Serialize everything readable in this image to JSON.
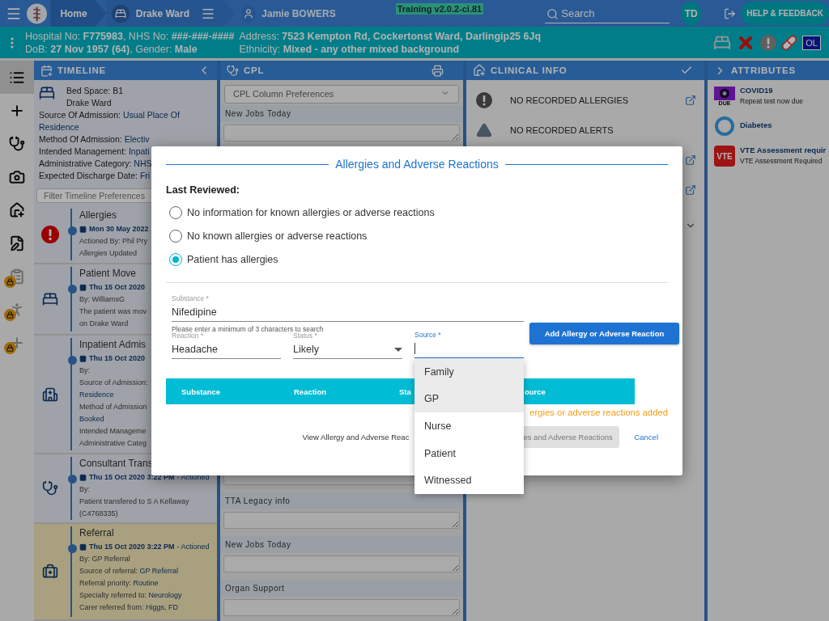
{
  "topbar": {
    "home": "Home",
    "ward": "Drake Ward",
    "patient": "Jamie BOWERS",
    "version": "Training v2.0.2-ci.81",
    "search": {
      "placeholder": "Search"
    },
    "avatar": "TD",
    "help": "HELP & FEEDBACK"
  },
  "patient_bar": {
    "left": [
      "Hospital No: **F775983**, NHS No: **###-###-####**",
      "DoB: **27 Nov 1957 (64)**, Gender: **Male**"
    ],
    "right": [
      "Address: **7523 Kempton Rd, Cockertonst Ward, Darlingip25 6Jq**",
      "Ethnicity: **Mixed - any other mixed background**"
    ],
    "badge": "OL"
  },
  "rail": [
    {
      "kind": "list",
      "selected": true,
      "locked": false
    },
    {
      "kind": "plus",
      "selected": false,
      "locked": false
    },
    {
      "kind": "stethoscope",
      "selected": false,
      "locked": false
    },
    {
      "kind": "camera",
      "selected": false,
      "locked": false
    },
    {
      "kind": "home",
      "selected": false,
      "locked": false
    },
    {
      "kind": "document",
      "selected": false,
      "locked": false
    },
    {
      "kind": "clipboard",
      "selected": false,
      "locked": true
    },
    {
      "kind": "walker",
      "selected": false,
      "locked": true
    },
    {
      "kind": "plus",
      "selected": false,
      "locked": true
    }
  ],
  "timeline": {
    "title": "TIMELINE",
    "bed": "Bed Space: B1",
    "ward": "Drake Ward",
    "summary": [
      "Source Of Admission: **Usual Place Of Residence**",
      "Method Of Admission: **Electiv**",
      "Intended Management: **Inpati**",
      "Administrative Category: **NHS**",
      "Expected Discharge Date: **Fri**"
    ],
    "filter": {
      "placeholder": "Filter Timeline Preferences"
    },
    "events": [
      {
        "kind": "alert",
        "title": "Allergies",
        "date": "Mon 30 May 2022",
        "lines": [
          "Actioned By: Phil Pry",
          "Allergies Updated"
        ],
        "highlighted": false
      },
      {
        "kind": "bed",
        "title": "Patient Move",
        "date": "Thu 15 Oct 2020",
        "lines": [
          "By: WilliamsG",
          "The patient was mov",
          "on Drake Ward"
        ],
        "highlighted": false
      },
      {
        "kind": "hospital",
        "title": "Inpatient Admis",
        "date": "Thu 15 Oct 2020",
        "lines": [
          "By:",
          "Source of Admission:",
          "**Residence**",
          "Method of Admission",
          "**Booked**",
          "Intended Manageme",
          "Administrative Categ"
        ],
        "highlighted": false
      },
      {
        "kind": "stethoscope",
        "title": "Consultant Trans",
        "date": "Thu 15 Oct 2020 3:22 PM",
        "status": "- Actioned",
        "lines": [
          "By:",
          "Patient transfered to S A Kellaway (C4768335)"
        ],
        "highlighted": false
      },
      {
        "kind": "medkit",
        "title": "Referral",
        "date": "Thu 15 Oct 2020 3:22 PM",
        "status": "- Actioned",
        "lines": [
          "By: GP Referral",
          "Source of referral: **GP Referral**",
          "Referral priority: **Routine**",
          "Specialty referred to: **Neurology**",
          "Carer referred from: **Higgs, FD**"
        ],
        "highlighted": true
      }
    ]
  },
  "cpl": {
    "title": "CPL",
    "select": "CPL Column Preferences",
    "sections": [
      {
        "label": "New Jobs Today"
      },
      {
        "label": "TTA Legacy info"
      },
      {
        "label": "New Jobs Today"
      },
      {
        "label": "Organ Support"
      }
    ]
  },
  "clinical_info": {
    "title": "CLINICAL INFO",
    "items": [
      {
        "kind": "allergy",
        "label": "NO RECORDED ALLERGIES"
      },
      {
        "kind": "alert",
        "label": "NO RECORDED ALERTS"
      }
    ]
  },
  "attributes": {
    "title": "ATTRIBUTES",
    "items": [
      {
        "kind": "covid",
        "badge": "DUE",
        "name": "COVID19",
        "detail": "Repeat test now due"
      },
      {
        "kind": "diabetes",
        "name": "Diabetes"
      },
      {
        "kind": "vte",
        "badge": "VTE",
        "name": "VTE Assessment requir",
        "detail": "VTE Assessment Required"
      }
    ]
  },
  "dialog": {
    "title": "Allergies and Adverse Reactions",
    "reviewed_label": "Last Reviewed:",
    "options": [
      {
        "label": "No information for known allergies or adverse reactions",
        "selected": false
      },
      {
        "label": "No known allergies or adverse reactions",
        "selected": false
      },
      {
        "label": "Patient has allergies",
        "selected": true
      }
    ],
    "substance": {
      "label": "Substance *",
      "value": "Nifedipine",
      "hint": "Please enter a minimum of 3 characters to search"
    },
    "reaction": {
      "label": "Reaction *",
      "value": "Headache"
    },
    "status": {
      "label": "Status *",
      "value": "Likely"
    },
    "source": {
      "label": "Source *",
      "focused": true
    },
    "add_button": "Add Allergy or Adverse Reaction",
    "table_columns": [
      "Substance",
      "Reaction",
      "Sta",
      "ource"
    ],
    "message": "ergies or adverse reactions added",
    "view_link": "View Allergy and Adverse Reac",
    "save_button": {
      "label": "es and Adverse Reactions",
      "disabled": true
    },
    "cancel": "Cancel",
    "source_menu": [
      {
        "label": "Family",
        "highlighted": true
      },
      {
        "label": "GP",
        "highlighted": true
      },
      {
        "label": "Nurse",
        "highlighted": false
      },
      {
        "label": "Patient",
        "highlighted": false
      },
      {
        "label": "Witnessed",
        "highlighted": false
      }
    ]
  }
}
